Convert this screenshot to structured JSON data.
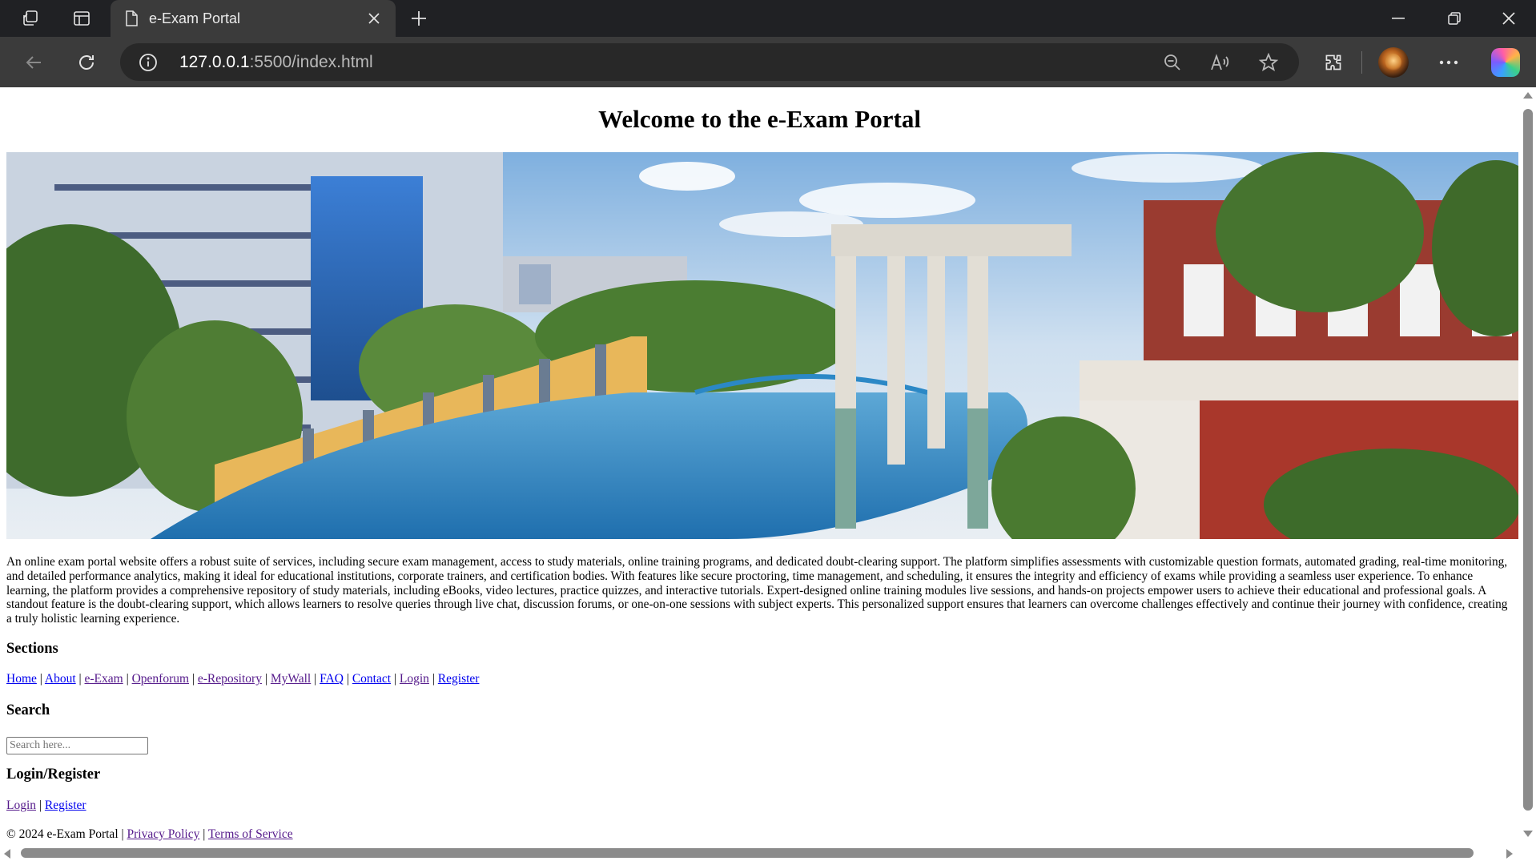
{
  "browser": {
    "tab_title": "e-Exam Portal",
    "url_host": "127.0.0.1",
    "url_rest": ":5500/index.html"
  },
  "page": {
    "title": "Welcome to the e-Exam Portal",
    "hero_image_icon": "campus-photo",
    "description": "An online exam portal website offers a robust suite of services, including secure exam management, access to study materials, online training programs, and dedicated doubt-clearing support. The platform simplifies assessments with customizable question formats, automated grading, real-time monitoring, and detailed performance analytics, making it ideal for educational institutions, corporate trainers, and certification bodies. With features like secure proctoring, time management, and scheduling, it ensures the integrity and efficiency of exams while providing a seamless user experience. To enhance learning, the platform provides a comprehensive repository of study materials, including eBooks, video lectures, practice quizzes, and interactive tutorials. Expert-designed online training modules live sessions, and hands-on projects empower users to achieve their educational and professional goals. A standout feature is the doubt-clearing support, which allows learners to resolve queries through live chat, discussion forums, or one-on-one sessions with subject experts. This personalized support ensures that learners can overcome challenges effectively and continue their journey with confidence, creating a truly holistic learning experience.",
    "sections_heading": "Sections",
    "sections": [
      {
        "label": "Home"
      },
      {
        "label": "About"
      },
      {
        "label": "e-Exam"
      },
      {
        "label": "Openforum"
      },
      {
        "label": "e-Repository"
      },
      {
        "label": "MyWall"
      },
      {
        "label": "FAQ"
      },
      {
        "label": "Contact"
      },
      {
        "label": "Login"
      },
      {
        "label": "Register"
      }
    ],
    "separator": "|",
    "search_heading": "Search",
    "search_placeholder": "Search here...",
    "auth_heading": "Login/Register",
    "auth_links": [
      {
        "label": "Login"
      },
      {
        "label": "Register"
      }
    ],
    "footer": {
      "copyright": "© 2024 e-Exam Portal",
      "privacy": "Privacy Policy",
      "terms": "Terms of Service"
    }
  }
}
